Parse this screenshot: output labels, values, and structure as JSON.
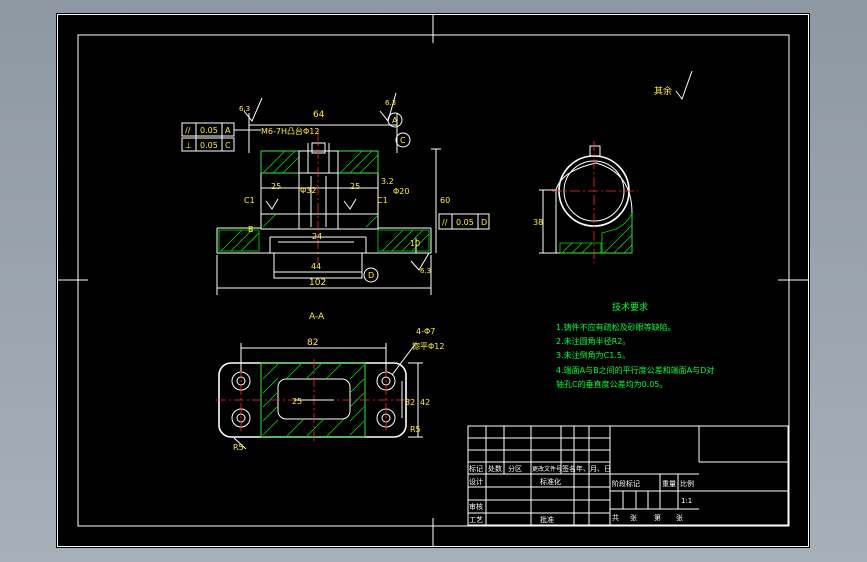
{
  "section_title": "A-A",
  "finish_note": "其余",
  "tech": {
    "title": "技术要求",
    "items": [
      "1.铸件不应有疏松及砂眼等缺陷。",
      "2.未注圆角半径R2。",
      "3.未注倒角为C1.5。",
      "4.端面A与B之间的平行度公差和端面A与D对",
      "轴孔C的垂直度公差均为0.05。"
    ]
  },
  "front": {
    "d64": "64",
    "d102": "102",
    "d44": "44",
    "d24": "24",
    "d10": "10",
    "d60": "60",
    "d25a": "25",
    "d25b": "25",
    "d32": "Φ32",
    "d20": "Φ20",
    "d3_2": "3.2",
    "c1a": "C1",
    "c1b": "C1",
    "ra63a": "6.3",
    "ra63b": "6.3",
    "ra63c": "6.3",
    "m6": "M6-7H凸台Φ12",
    "datum_a": "A",
    "datum_b": "B",
    "datum_c": "C",
    "datum_d": "D",
    "fcf1": [
      "//",
      "0.05",
      "A"
    ],
    "fcf2": [
      "⊥",
      "0.05",
      "C"
    ],
    "fcf3": [
      "//",
      "0.05",
      "D"
    ]
  },
  "side": {
    "d38": "38"
  },
  "top": {
    "d82": "82",
    "d25": "25",
    "d32": "32",
    "d42": "42",
    "r5a": "R5",
    "r5b": "R5",
    "holes": "4-Φ7",
    "spot": "锪平Φ12"
  },
  "titleblock": {
    "row1": [
      "标记",
      "处数",
      "分区",
      "更改文件号",
      "签名",
      "年、月、日"
    ],
    "design": "设计",
    "standard": "标准化",
    "stage": [
      "阶段标记",
      "重量",
      "比例"
    ],
    "scale": "1:1",
    "check": "审核",
    "process": "工艺",
    "approve": "批准",
    "sheets": [
      "共",
      "张",
      "第",
      "张"
    ]
  }
}
